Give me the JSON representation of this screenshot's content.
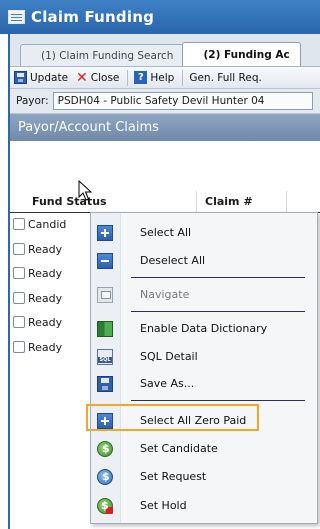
{
  "window": {
    "title": "Claim Funding",
    "accent": "#2a66ab"
  },
  "tabs": [
    {
      "label": "(1) Claim Funding Search"
    },
    {
      "label": "(2) Funding Ac"
    }
  ],
  "toolbar": {
    "update_label": "Update",
    "close_label": "Close",
    "help_label": "Help",
    "gen_label": "Gen. Full Req."
  },
  "payor": {
    "label": "Payor:",
    "value": "PSDH04 - Public Safety Devil Hunter 04"
  },
  "panel": {
    "title": "Payor/Account Claims"
  },
  "grid": {
    "columns": [
      "Fund Status",
      "Claim #"
    ],
    "rows": [
      "Candid",
      "Ready",
      "Ready",
      "Ready",
      "Ready",
      "Ready"
    ]
  },
  "context_menu": {
    "items": [
      {
        "label": "Select All",
        "icon": "select-all-icon"
      },
      {
        "label": "Deselect All",
        "icon": "deselect-all-icon"
      },
      {
        "label": "Navigate",
        "icon": "navigate-icon",
        "disabled": true
      },
      {
        "label": "Enable Data Dictionary",
        "icon": "data-dictionary-icon"
      },
      {
        "label": "SQL Detail",
        "icon": "sql-icon"
      },
      {
        "label": "Save As...",
        "icon": "save-icon"
      },
      {
        "label": "Select All Zero Paid",
        "icon": "select-zero-paid-icon"
      },
      {
        "label": "Set Candidate",
        "icon": "money-icon"
      },
      {
        "label": "Set Request",
        "icon": "money-request-icon"
      },
      {
        "label": "Set Hold",
        "icon": "money-hold-icon"
      }
    ],
    "highlight_color": "#f4a52a"
  }
}
